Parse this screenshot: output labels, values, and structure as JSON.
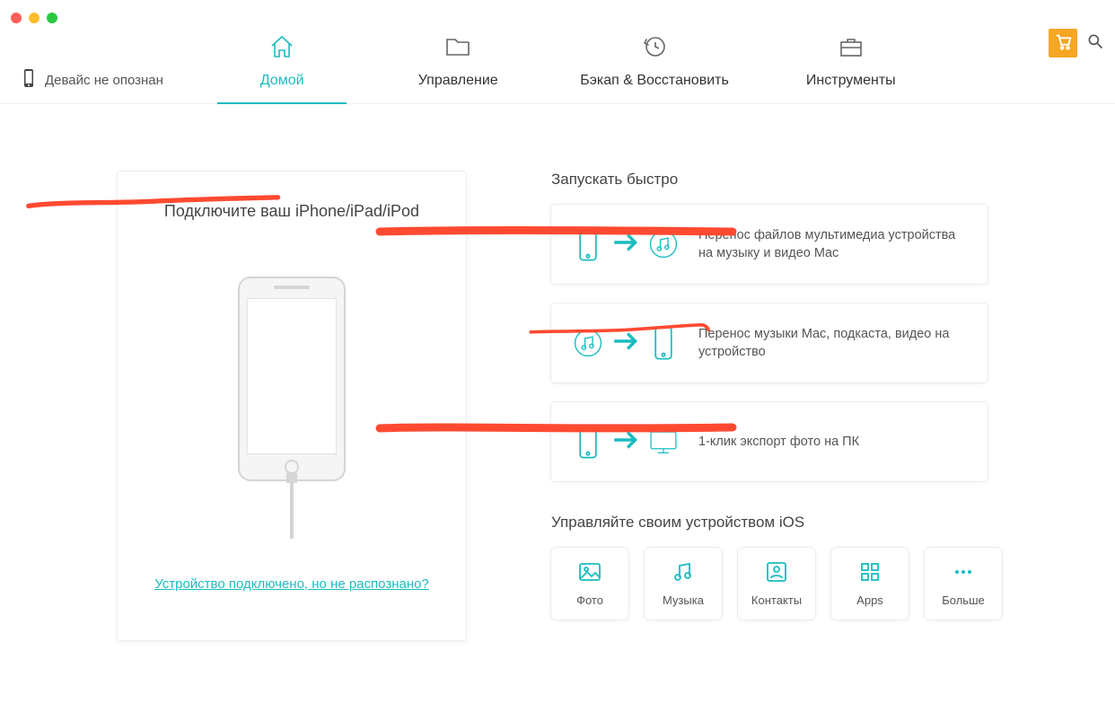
{
  "device_status_label": "Девайс не опознан",
  "nav": {
    "home": "Домой",
    "manage": "Управление",
    "backup": "Бэкап & Восстановить",
    "tools": "Инструменты"
  },
  "connect": {
    "title": "Подключите ваш iPhone/iPad/iPod",
    "help_link": "Устройство подключено, но не распознано?"
  },
  "quick": {
    "title": "Запускать быстро",
    "item1": "Перенос файлов мультимедиа устройства на музыку и видео Mac",
    "item2": "Перенос музыки Mac, подкаста, видео на устройство",
    "item3": "1-клик экспорт фото на ПК"
  },
  "manage": {
    "title": "Управляйте своим устройством iOS",
    "photo": "Фото",
    "music": "Музыка",
    "contacts": "Контакты",
    "apps": "Apps",
    "more": "Больше"
  },
  "colors": {
    "accent": "#1abcc0",
    "annotation": "#ff4a31",
    "cart": "#f5a623"
  }
}
